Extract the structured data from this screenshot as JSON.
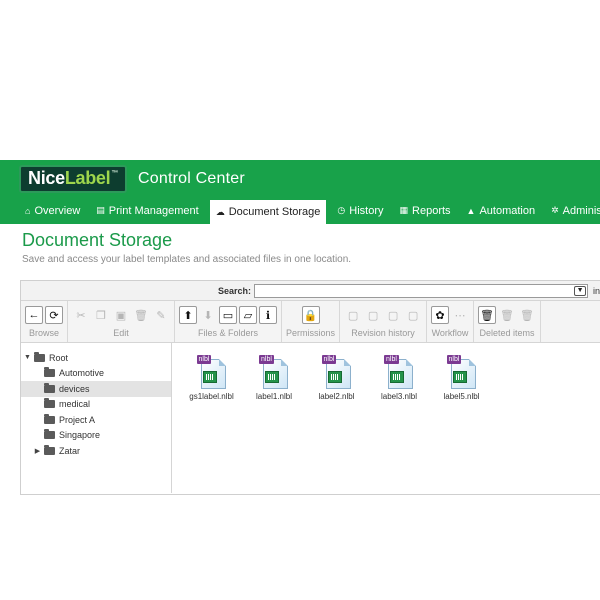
{
  "brand": {
    "nice": "Nice",
    "label": "Label",
    "tm": "™"
  },
  "app_title": "Control Center",
  "nav": [
    {
      "label": "Overview",
      "icon": "home-icon",
      "glyph": "⌂",
      "active": false
    },
    {
      "label": "Print Management",
      "icon": "printer-icon",
      "glyph": "▤",
      "active": false
    },
    {
      "label": "Document Storage",
      "icon": "storage-icon",
      "glyph": "☁",
      "active": true
    },
    {
      "label": "History",
      "icon": "history-icon",
      "glyph": "◷",
      "active": false
    },
    {
      "label": "Reports",
      "icon": "reports-icon",
      "glyph": "▦",
      "active": false
    },
    {
      "label": "Automation",
      "icon": "automation-icon",
      "glyph": "▲",
      "active": false
    },
    {
      "label": "Administration",
      "icon": "gears-icon",
      "glyph": "✲",
      "active": false
    }
  ],
  "page": {
    "title": "Document Storage",
    "subtitle": "Save and access your label templates and associated files in one location."
  },
  "search": {
    "label": "Search:",
    "value": "",
    "suffix": "in"
  },
  "toolbar": [
    {
      "label": "Browse",
      "buttons": [
        {
          "icon": "back-arrow-icon",
          "glyph": "←",
          "enabled": true
        },
        {
          "icon": "refresh-icon",
          "glyph": "⟳",
          "enabled": true
        }
      ]
    },
    {
      "label": "Edit",
      "buttons": [
        {
          "icon": "cut-icon",
          "glyph": "✂",
          "enabled": false
        },
        {
          "icon": "copy-icon",
          "glyph": "❐",
          "enabled": false
        },
        {
          "icon": "paste-icon",
          "glyph": "▣",
          "enabled": false
        },
        {
          "icon": "delete-icon",
          "glyph": "🗑",
          "enabled": false
        },
        {
          "icon": "rename-icon",
          "glyph": "✎",
          "enabled": false
        }
      ]
    },
    {
      "label": "Files & Folders",
      "buttons": [
        {
          "icon": "upload-icon",
          "glyph": "⬆",
          "enabled": true
        },
        {
          "icon": "download-icon",
          "glyph": "⬇",
          "enabled": false
        },
        {
          "icon": "new-folder-icon",
          "glyph": "▭",
          "enabled": true
        },
        {
          "icon": "open-folder-icon",
          "glyph": "▱",
          "enabled": true
        },
        {
          "icon": "info-icon",
          "glyph": "ℹ",
          "enabled": true
        }
      ]
    },
    {
      "label": "Permissions",
      "buttons": [
        {
          "icon": "lock-icon",
          "glyph": "🔒",
          "enabled": true
        }
      ]
    },
    {
      "label": "Revision history",
      "buttons": [
        {
          "icon": "checkout-icon",
          "glyph": "▢",
          "enabled": false
        },
        {
          "icon": "checkin-icon",
          "glyph": "▢",
          "enabled": false
        },
        {
          "icon": "undo-checkout-icon",
          "glyph": "▢",
          "enabled": false
        },
        {
          "icon": "history-doc-icon",
          "glyph": "▢",
          "enabled": false
        }
      ]
    },
    {
      "label": "Workflow",
      "buttons": [
        {
          "icon": "workflow-icon",
          "glyph": "✿",
          "enabled": true
        },
        {
          "icon": "workflow-steps-icon",
          "glyph": "⋯",
          "enabled": false
        }
      ]
    },
    {
      "label": "Deleted items",
      "buttons": [
        {
          "icon": "recycle-bin-icon",
          "glyph": "🗑",
          "enabled": true
        },
        {
          "icon": "restore-icon",
          "glyph": "🗑",
          "enabled": false
        },
        {
          "icon": "purge-icon",
          "glyph": "🗑",
          "enabled": false
        }
      ]
    }
  ],
  "tree": [
    {
      "label": "Root",
      "level": 0,
      "expander": "▼",
      "selected": false
    },
    {
      "label": "Automotive",
      "level": 1,
      "expander": "",
      "selected": false
    },
    {
      "label": "devices",
      "level": 1,
      "expander": "",
      "selected": true
    },
    {
      "label": "medical",
      "level": 1,
      "expander": "",
      "selected": false
    },
    {
      "label": "Project A",
      "level": 1,
      "expander": "",
      "selected": false
    },
    {
      "label": "Singapore",
      "level": 1,
      "expander": "",
      "selected": false
    },
    {
      "label": "Zatar",
      "level": 1,
      "expander": "▶",
      "selected": false
    }
  ],
  "file_type_badge": "nlbl",
  "files": [
    {
      "name": "gs1label.nlbl"
    },
    {
      "name": "label1.nlbl"
    },
    {
      "name": "label2.nlbl"
    },
    {
      "name": "label3.nlbl"
    },
    {
      "name": "label5.nlbl"
    }
  ]
}
